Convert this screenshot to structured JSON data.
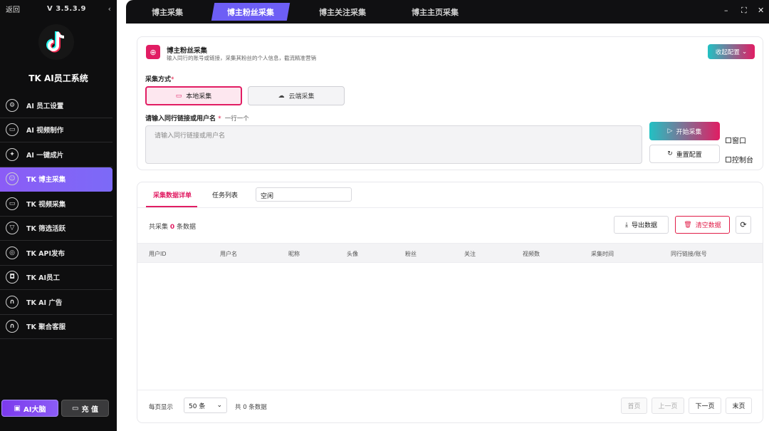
{
  "sidebar": {
    "back_label": "返回",
    "version": "V 3.5.3.9",
    "collapse_icon": "‹",
    "app_name": "TK AI员工系统",
    "items": [
      {
        "label": "AI 员工设置",
        "icon": "gear-icon",
        "glyph": "⚙"
      },
      {
        "label": "AI 视频制作",
        "icon": "video-icon",
        "glyph": "▭"
      },
      {
        "label": "AI 一键成片",
        "icon": "sparkle-icon",
        "glyph": "✦"
      },
      {
        "label": "TK 博主采集",
        "icon": "users-icon",
        "glyph": "☺"
      },
      {
        "label": "TK 视频采集",
        "icon": "video-icon",
        "glyph": "▭"
      },
      {
        "label": "TK 筛选活跃",
        "icon": "filter-icon",
        "glyph": "▽"
      },
      {
        "label": "TK API发布",
        "icon": "target-icon",
        "glyph": "◎"
      },
      {
        "label": "TK AI员工",
        "icon": "robot-icon",
        "glyph": "◘"
      },
      {
        "label": "TK AI 广告",
        "icon": "headset-icon",
        "glyph": "∩"
      },
      {
        "label": "TK 聚合客服",
        "icon": "headset-icon",
        "glyph": "∩"
      }
    ],
    "active_index": 3,
    "ai_brain_label": "AI大脑",
    "recharge_label": "充 值"
  },
  "topbar": {
    "tabs": [
      "博主采集",
      "博主粉丝采集",
      "博主关注采集",
      "博主主页采集"
    ],
    "active_tab": 1,
    "minimize": "–",
    "maximize": "⛶",
    "close": "✕"
  },
  "card1": {
    "title": "博主粉丝采集",
    "subtitle": "输入同行的账号或链接，采集其粉丝的个人信息，截流精准营销",
    "collapse_label": "收起配置",
    "mode_label": "采集方式",
    "mode_required": "*",
    "modes": [
      "本地采集",
      "云端采集"
    ],
    "input_label": "请输入同行链接或用户名",
    "input_required": "*",
    "input_hint": "一行一个",
    "input_placeholder": "请输入同行链接或用户名",
    "start_label": "开始采集",
    "reset_label": "重置配置",
    "window_label": "窗口",
    "console_label": "控制台"
  },
  "card2": {
    "tabs": [
      "采集数据详单",
      "任务列表"
    ],
    "status_value": "空闲",
    "total_prefix": "共采集",
    "total_count": "0",
    "total_suffix": "条数据",
    "export_label": "导出数据",
    "clear_label": "清空数据",
    "columns": [
      "用户ID",
      "用户名",
      "昵称",
      "头像",
      "粉丝",
      "关注",
      "视频数",
      "采集时间",
      "同行链接/账号"
    ],
    "pagination": {
      "per_page_label": "每页显示",
      "per_page_value": "50 条",
      "total_text": "共 0 条数据",
      "first": "首页",
      "prev": "上一页",
      "next": "下一页",
      "last": "末页"
    }
  },
  "colors": {
    "accent_pink": "#e11d63",
    "accent_purple": "#7c6af7",
    "sidebar_bg": "#0e0e0f"
  }
}
